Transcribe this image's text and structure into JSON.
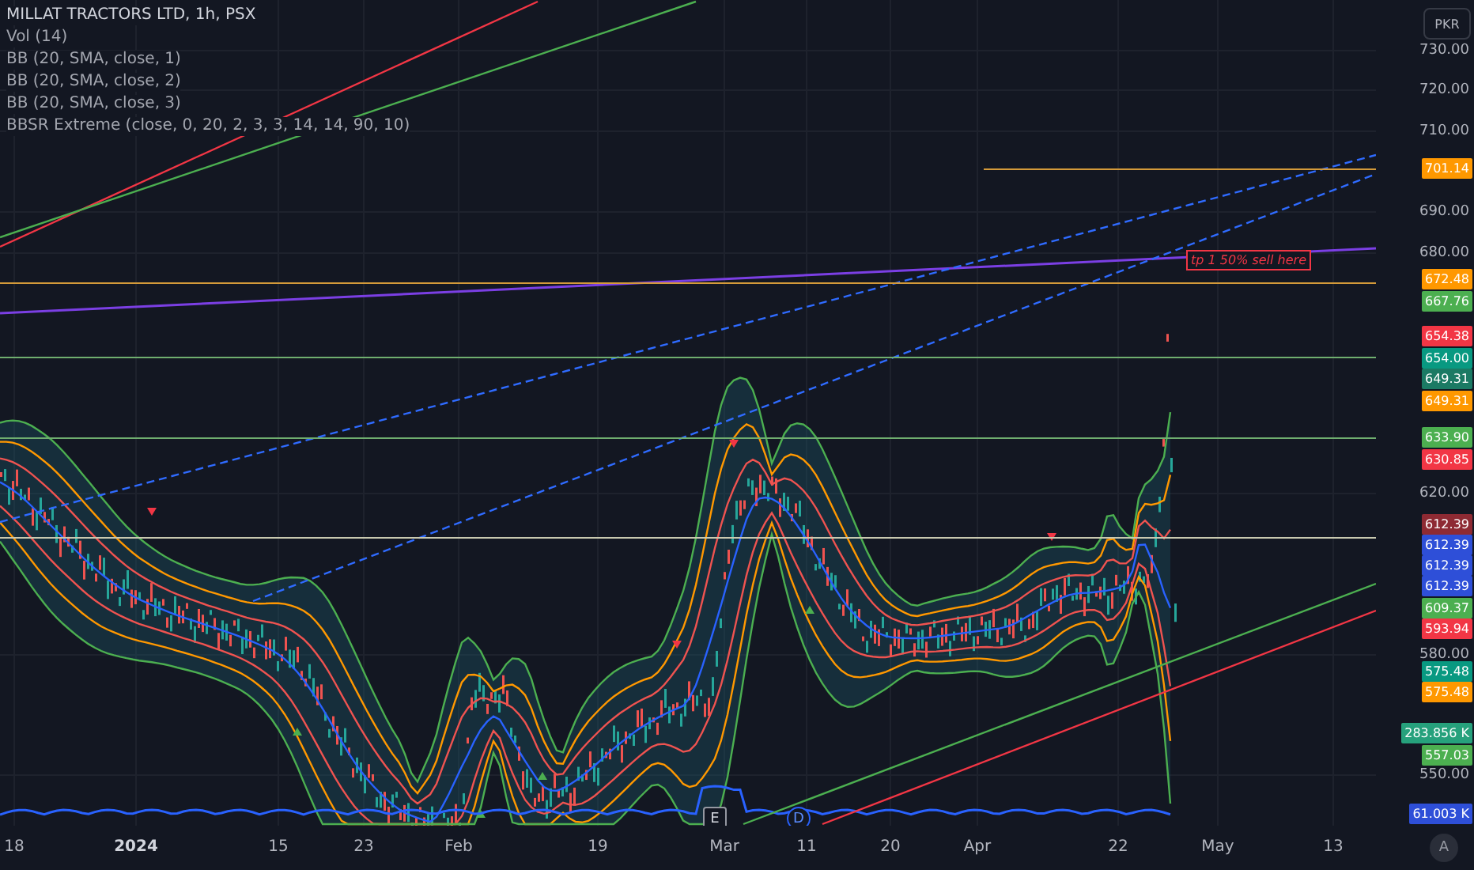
{
  "symbol_title": "MILLAT TRACTORS LTD, 1h, PSX",
  "legend": [
    "Vol (14)",
    "BB (20, SMA, close, 1)",
    "BB (20, SMA, close, 2)",
    "BB (20, SMA, close, 3)",
    "BBSR Extreme (close, 0, 20, 2, 3, 3, 14, 14, 90, 10)"
  ],
  "currency": "PKR",
  "price_axis": [
    "730.00",
    "720.00",
    "710.00",
    "690.00",
    "680.00",
    "620.00",
    "580.00",
    "550.00"
  ],
  "price_tags": [
    {
      "text": "701.14",
      "color": "#ff9800"
    },
    {
      "text": "672.48",
      "color": "#ff9800"
    },
    {
      "text": "667.76",
      "color": "#4caf50"
    },
    {
      "text": "654.38",
      "color": "#f23645"
    },
    {
      "text": "654.00",
      "color": "#089981"
    },
    {
      "text": "649.31",
      "color": "#1b7a64"
    },
    {
      "text": "649.31",
      "color": "#ff9800"
    },
    {
      "text": "633.90",
      "color": "#4caf50"
    },
    {
      "text": "630.85",
      "color": "#f23645"
    },
    {
      "text": "612.39",
      "color": "#8e2a33"
    },
    {
      "text": "612.39",
      "color": "#2e4fd8"
    },
    {
      "text": "612.39",
      "color": "#2e4fd8"
    },
    {
      "text": "612.39",
      "color": "#2e4fd8"
    },
    {
      "text": "609.37",
      "color": "#4caf50"
    },
    {
      "text": "593.94",
      "color": "#f23645"
    },
    {
      "text": "575.48",
      "color": "#089981"
    },
    {
      "text": "575.48",
      "color": "#ff9800"
    },
    {
      "text": "283.856 K",
      "color": "#26a17c"
    },
    {
      "text": "557.03",
      "color": "#4caf50"
    },
    {
      "text": "61.003 K",
      "color": "#2e4fd8"
    }
  ],
  "annotation": "tp 1 50% sell here",
  "event_markers": [
    "E",
    "D"
  ],
  "time_axis": [
    {
      "label": "18",
      "emphasis": false
    },
    {
      "label": "2024",
      "emphasis": true
    },
    {
      "label": "15",
      "emphasis": false
    },
    {
      "label": "23",
      "emphasis": false
    },
    {
      "label": "Feb",
      "emphasis": false
    },
    {
      "label": "19",
      "emphasis": false
    },
    {
      "label": "Mar",
      "emphasis": false
    },
    {
      "label": "11",
      "emphasis": false
    },
    {
      "label": "20",
      "emphasis": false
    },
    {
      "label": "Apr",
      "emphasis": false
    },
    {
      "label": "22",
      "emphasis": false
    },
    {
      "label": "May",
      "emphasis": false
    },
    {
      "label": "13",
      "emphasis": false
    }
  ],
  "auto_scale": "A"
}
